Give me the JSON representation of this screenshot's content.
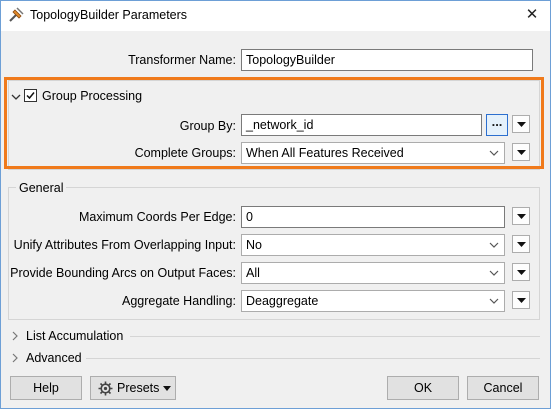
{
  "window": {
    "title": "TopologyBuilder Parameters"
  },
  "transformer": {
    "label": "Transformer Name:",
    "value": "TopologyBuilder"
  },
  "group_processing": {
    "label": "Group Processing",
    "checked": true,
    "group_by": {
      "label": "Group By:",
      "value": "_network_id",
      "ellipsis": "..."
    },
    "complete_groups": {
      "label": "Complete Groups:",
      "value": "When All Features Received"
    }
  },
  "general": {
    "title": "General",
    "max_coords": {
      "label": "Maximum Coords Per Edge:",
      "value": "0"
    },
    "unify_attrs": {
      "label": "Unify Attributes From Overlapping Input:",
      "value": "No"
    },
    "bounding_arcs": {
      "label": "Provide Bounding Arcs on Output Faces:",
      "value": "All"
    },
    "aggregate": {
      "label": "Aggregate Handling:",
      "value": "Deaggregate"
    }
  },
  "sections": {
    "list_accumulation": "List Accumulation",
    "advanced": "Advanced"
  },
  "footer": {
    "help": "Help",
    "presets": "Presets",
    "ok": "OK",
    "cancel": "Cancel"
  },
  "colors": {
    "highlight": "#f07a1b",
    "accent": "#2c6fcf"
  }
}
